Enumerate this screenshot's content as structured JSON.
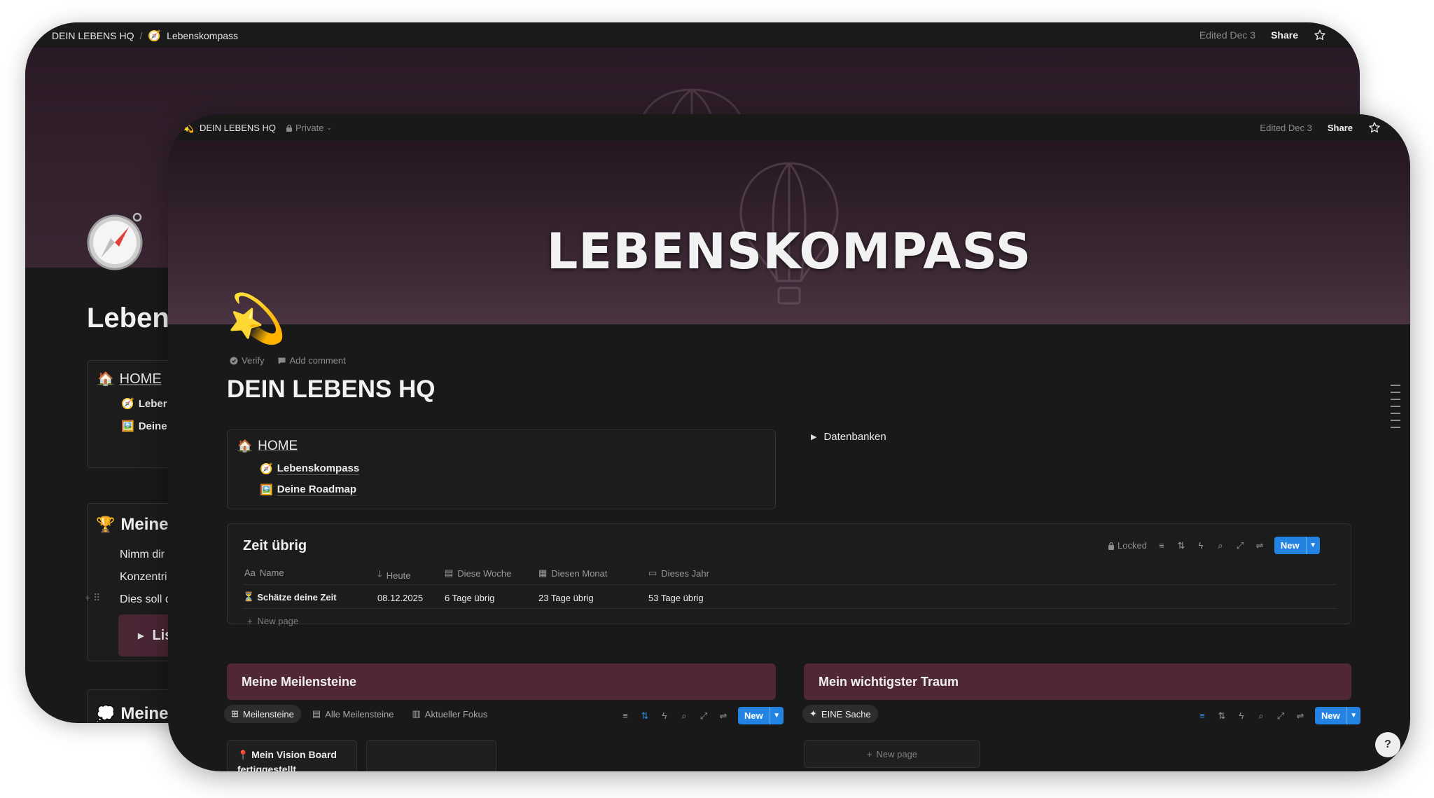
{
  "back_window": {
    "breadcrumb": {
      "workspace": "DEIN LEBENS HQ",
      "page": "Lebenskompass",
      "page_icon": "compass-icon"
    },
    "edited": "Edited Dec 3",
    "share": "Share",
    "page_title": "Lebens",
    "home": {
      "label": "HOME",
      "items": [
        "Leber",
        "Deine"
      ]
    },
    "section_meine_1": {
      "label": "Meine",
      "lines": [
        "Nimm dir",
        "Konzentri",
        "Dies soll d"
      ],
      "toggle": "Lis"
    },
    "section_meine_2": {
      "label": "Meine"
    }
  },
  "front_window": {
    "breadcrumb": {
      "workspace": "DEIN LEBENS HQ",
      "privacy": "Private"
    },
    "edited": "Edited Dec 3",
    "share": "Share",
    "cover_title": "LEBENSKOMPASS",
    "page_icon": "dizzy-star-icon",
    "meta": {
      "verify": "Verify",
      "add_comment": "Add comment"
    },
    "page_title": "DEIN LEBENS HQ",
    "home_card": {
      "home_label": "HOME",
      "links": [
        {
          "icon": "compass-icon",
          "label": "Lebenskompass"
        },
        {
          "icon": "picture-icon",
          "label": "Deine Roadmap"
        }
      ]
    },
    "toggle_datenbanken": "Datenbanken",
    "zeit_db": {
      "title": "Zeit übrig",
      "locked": "Locked",
      "new_label": "New",
      "columns": [
        "Name",
        "Heute",
        "Diese Woche",
        "Diesen Monat",
        "Dieses Jahr"
      ],
      "rows": [
        {
          "name": "Schätze deine Zeit",
          "heute": "08.12.2025",
          "woche": "6 Tage übrig",
          "monat": "23 Tage übrig",
          "jahr": "53 Tage übrig"
        }
      ],
      "new_page": "New page"
    },
    "meilensteine": {
      "title": "Meine Meilensteine",
      "views": [
        "Meilensteine",
        "Alle Meilensteine",
        "Aktueller Fokus"
      ],
      "new_label": "New",
      "card_text": "Mein Vision Board fertiggestellt"
    },
    "traum": {
      "title": "Mein wichtigster Traum",
      "view": "EINE Sache",
      "new_label": "New",
      "new_page": "New page"
    }
  },
  "colors": {
    "accent_blue": "#2383e2",
    "band_purple": "#4f2737",
    "background": "#191919"
  }
}
